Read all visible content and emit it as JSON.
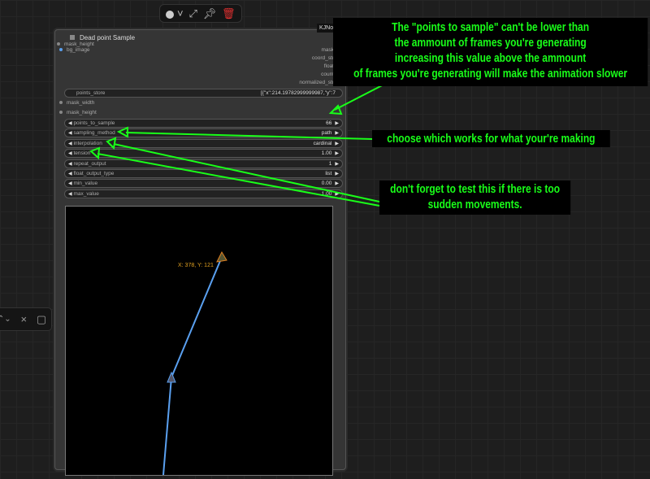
{
  "toolbar": {
    "color": "color-picker",
    "bypass": "bypass",
    "pin": "pin",
    "delete": "delete"
  },
  "node": {
    "title": "Dead point Sample",
    "badge": "KJNodes",
    "inputs": [
      "mask_height",
      "bg_image"
    ],
    "outputs": [
      "mask",
      "coord_str",
      "float",
      "count",
      "normalized_str"
    ],
    "points_store": {
      "label": "points_store",
      "value": "[{\"x\":214.19782999999987,\"y\":7"
    },
    "mask_width": "mask_width",
    "mask_height": "mask_height",
    "widgets": [
      {
        "label": "points_to_sample",
        "value": "66"
      },
      {
        "label": "sampling_method",
        "value": "path"
      },
      {
        "label": "interpolation",
        "value": "cardinal"
      },
      {
        "label": "tension",
        "value": "1.00"
      },
      {
        "label": "repeat_output",
        "value": "1"
      },
      {
        "label": "float_output_type",
        "value": "list"
      },
      {
        "label": "min_value",
        "value": "0.00"
      },
      {
        "label": "max_value",
        "value": "1.00"
      }
    ],
    "coord_label": "X: 378, Y: 121"
  },
  "notes": {
    "n1": "The \"points to sample\" can't be lower than the ammount of frames you're generating increasing this value above the ammount of frames you're generating will make the animation slower",
    "n1_lines": [
      "The \"points to sample\" can't be lower than",
      "the ammount of frames you're generating",
      "increasing this value above the ammount",
      "of frames you're generating will make the animation slower"
    ],
    "n2": "choose which works for what your're making",
    "n3_lines": [
      "don't forget to test this if there is too",
      "sudden movements."
    ]
  },
  "colors": {
    "annotation": "#19ff19",
    "line": "#5aa0f0",
    "delete": "#e03030"
  }
}
